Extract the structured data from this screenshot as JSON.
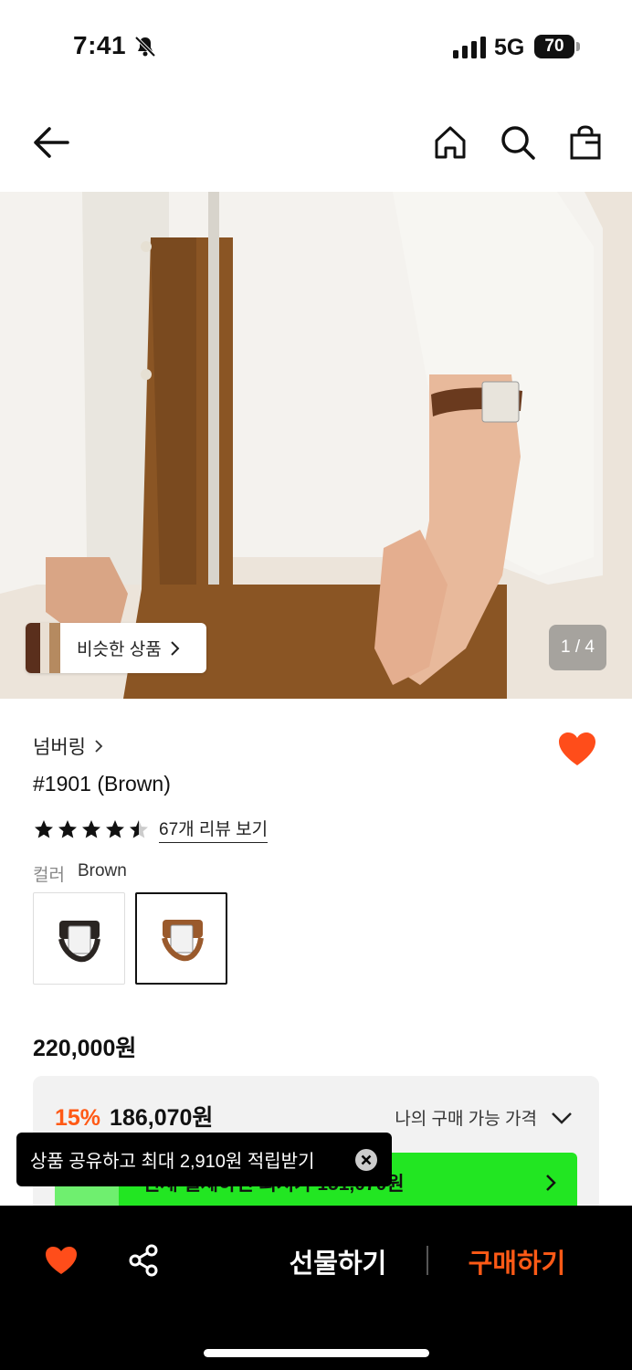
{
  "status_bar": {
    "time": "7:41",
    "network": "5G",
    "battery": "70"
  },
  "hero": {
    "similar_label": "비슷한 상품",
    "page_indicator": "1 / 4"
  },
  "product": {
    "brand": "넘버링",
    "name": "#1901 (Brown)",
    "rating": 4.5,
    "review_link": "67개 리뷰 보기",
    "color_key": "컬러",
    "color_value": "Brown",
    "original_price": "220,000원",
    "discount_rate": "15%",
    "discount_price": "186,070원",
    "my_price_label": "나의 구매 가능 가격",
    "promo_text": "현재 결제하면 최저가 151,070원"
  },
  "toast": {
    "text": "상품 공유하고 최대 2,910원 적립받기"
  },
  "bottom_bar": {
    "gift_label": "선물하기",
    "buy_label": "구매하기"
  },
  "colors": {
    "accent": "#ff5a16",
    "promo_green": "#22e622",
    "heart": "#ff4d1a"
  }
}
